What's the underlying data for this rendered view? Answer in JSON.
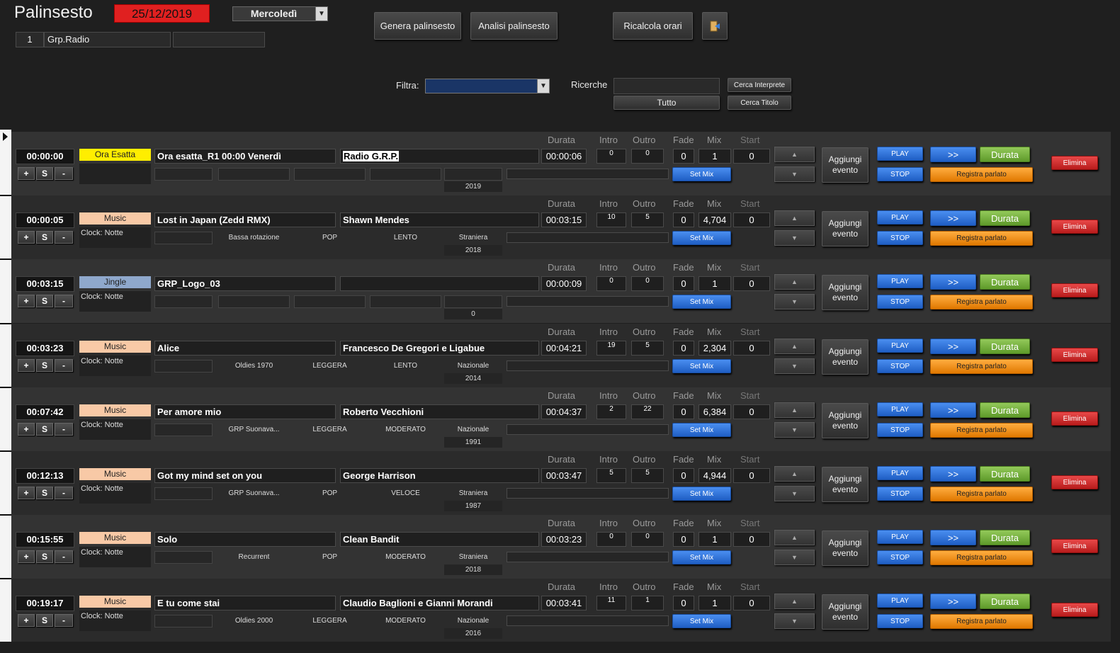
{
  "header": {
    "title": "Palinsesto",
    "date": "25/12/2019",
    "day": "Mercoledì",
    "group_number": "1",
    "group_name": "Grp.Radio",
    "group_extra": ""
  },
  "toolbar": {
    "genera": "Genera palinsesto",
    "analisi": "Analisi palinsesto",
    "ricalcola": "Ricalcola orari"
  },
  "filters": {
    "filtra_label": "Filtra:",
    "filtra_value": "",
    "ricerche_label": "Ricerche",
    "ricerche_value": "",
    "tutto": "Tutto",
    "cerca_interprete": "Cerca Interprete",
    "cerca_titolo": "Cerca Titolo"
  },
  "columns": {
    "durata": "Durata",
    "intro": "Intro",
    "outro": "Outro",
    "fade": "Fade",
    "mix": "Mix",
    "start": "Start"
  },
  "buttons": {
    "plus": "+",
    "s": "S",
    "minus": "-",
    "set_mix": "Set Mix",
    "aggiungi": "Aggiungi evento",
    "play": "PLAY",
    "stop": "STOP",
    "forward": ">>",
    "durata": "Durata",
    "registra": "Registra parlato",
    "elimina": "Elimina"
  },
  "colors": {
    "ora_esatta": "#ffee00",
    "music": "#f8c9a6",
    "jingle": "#8fa8cc",
    "date_bg": "#e02020"
  },
  "rows": [
    {
      "time": "00:00:00",
      "type": "Ora Esatta",
      "type_color": "#ffee00",
      "clock": "",
      "title": "Ora esatta_R1 00:00 Venerdì",
      "artist": "Radio G.R.P.",
      "duration": "00:00:06",
      "intro": "0",
      "outro": "0",
      "fade": "0",
      "mix": "1",
      "start": "0",
      "rotation": "",
      "genre": "",
      "tempo": "",
      "origin": "",
      "year": "2019"
    },
    {
      "time": "00:00:05",
      "type": "Music",
      "type_color": "#f8c9a6",
      "clock": "Clock: Notte",
      "title": "Lost in Japan (Zedd RMX)",
      "artist": "Shawn Mendes",
      "duration": "00:03:15",
      "intro": "10",
      "outro": "5",
      "fade": "0",
      "mix": "4,704",
      "start": "0",
      "rotation": "Bassa rotazione",
      "genre": "POP",
      "tempo": "LENTO",
      "origin": "Straniera",
      "year": "2018"
    },
    {
      "time": "00:03:15",
      "type": "Jingle",
      "type_color": "#8fa8cc",
      "clock": "Clock: Notte",
      "title": "GRP_Logo_03",
      "artist": "",
      "duration": "00:00:09",
      "intro": "0",
      "outro": "0",
      "fade": "0",
      "mix": "1",
      "start": "0",
      "rotation": "",
      "genre": "",
      "tempo": "",
      "origin": "",
      "year": "0"
    },
    {
      "time": "00:03:23",
      "type": "Music",
      "type_color": "#f8c9a6",
      "clock": "Clock: Notte",
      "title": "Alice",
      "artist": "Francesco De Gregori e Ligabue",
      "duration": "00:04:21",
      "intro": "19",
      "outro": "5",
      "fade": "0",
      "mix": "2,304",
      "start": "0",
      "rotation": "Oldies 1970",
      "genre": "LEGGERA",
      "tempo": "LENTO",
      "origin": "Nazionale",
      "year": "2014"
    },
    {
      "time": "00:07:42",
      "type": "Music",
      "type_color": "#f8c9a6",
      "clock": "Clock: Notte",
      "title": "Per amore mio",
      "artist": "Roberto Vecchioni",
      "duration": "00:04:37",
      "intro": "2",
      "outro": "22",
      "fade": "0",
      "mix": "6,384",
      "start": "0",
      "rotation": "GRP Suonava...",
      "genre": "LEGGERA",
      "tempo": "MODERATO",
      "origin": "Nazionale",
      "year": "1991"
    },
    {
      "time": "00:12:13",
      "type": "Music",
      "type_color": "#f8c9a6",
      "clock": "Clock: Notte",
      "title": "Got my mind set on you",
      "artist": "George Harrison",
      "duration": "00:03:47",
      "intro": "5",
      "outro": "5",
      "fade": "0",
      "mix": "4,944",
      "start": "0",
      "rotation": "GRP Suonava...",
      "genre": "POP",
      "tempo": "VELOCE",
      "origin": "Straniera",
      "year": "1987"
    },
    {
      "time": "00:15:55",
      "type": "Music",
      "type_color": "#f8c9a6",
      "clock": "Clock: Notte",
      "title": "Solo",
      "artist": "Clean Bandit",
      "duration": "00:03:23",
      "intro": "0",
      "outro": "0",
      "fade": "0",
      "mix": "1",
      "start": "0",
      "rotation": "Recurrent",
      "genre": "POP",
      "tempo": "MODERATO",
      "origin": "Straniera",
      "year": "2018"
    },
    {
      "time": "00:19:17",
      "type": "Music",
      "type_color": "#f8c9a6",
      "clock": "Clock: Notte",
      "title": "E tu come stai",
      "artist": "Claudio Baglioni e Gianni Morandi",
      "duration": "00:03:41",
      "intro": "11",
      "outro": "1",
      "fade": "0",
      "mix": "1",
      "start": "0",
      "rotation": "Oldies 2000",
      "genre": "LEGGERA",
      "tempo": "MODERATO",
      "origin": "Nazionale",
      "year": "2016"
    }
  ]
}
